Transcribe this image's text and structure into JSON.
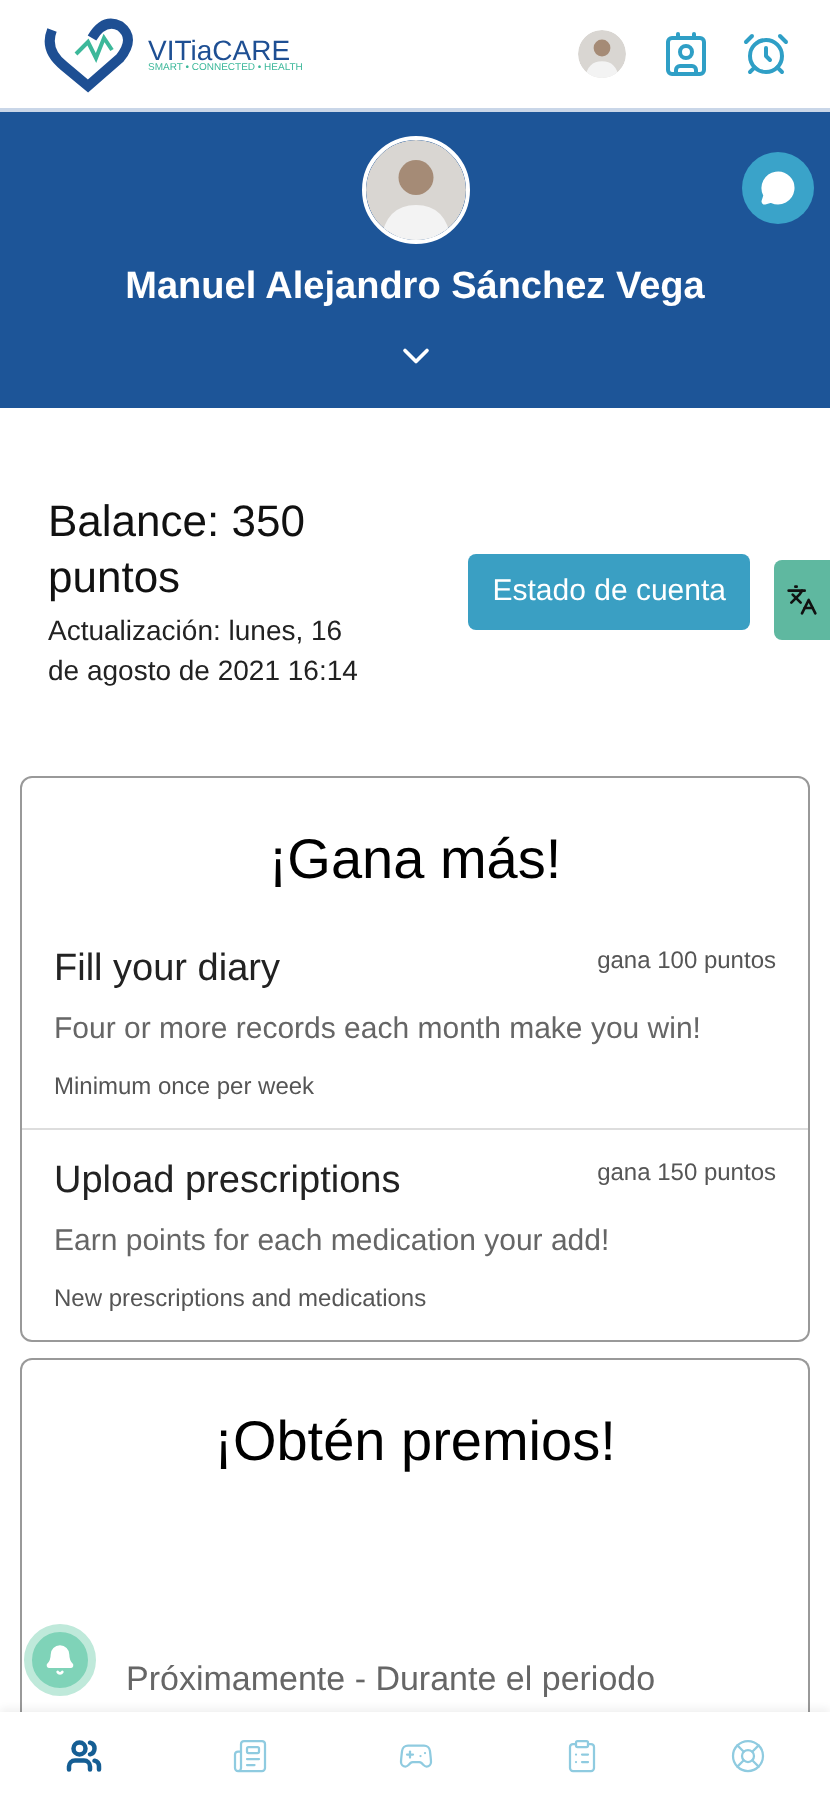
{
  "header": {
    "brand": "VITiaCARE",
    "tagline": "SMART • CONNECTED • HEALTH"
  },
  "profile": {
    "name": "Manuel Alejandro Sánchez Vega"
  },
  "balance": {
    "title": "Balance: 350 puntos",
    "updated": "Actualización: lunes, 16 de agosto de 2021 16:14",
    "button": "Estado de cuenta"
  },
  "earn": {
    "title": "¡Gana más!",
    "items": [
      {
        "title": "Fill your diary",
        "points": "gana 100 puntos",
        "description": "Four or more records each month make you win!",
        "note": "Minimum once per week"
      },
      {
        "title": "Upload prescriptions",
        "points": "gana 150 puntos",
        "description": "Earn points for each medication your add!",
        "note": "New prescriptions and medications"
      }
    ]
  },
  "rewards": {
    "title": "¡Obtén premios!",
    "text": "Próximamente - Durante el periodo"
  },
  "bottom_nav": [
    {
      "kind": "people",
      "selected": true
    },
    {
      "kind": "list",
      "selected": false
    },
    {
      "kind": "gamepad",
      "selected": false
    },
    {
      "kind": "report",
      "selected": false
    },
    {
      "kind": "lifebuoy",
      "selected": false
    }
  ]
}
